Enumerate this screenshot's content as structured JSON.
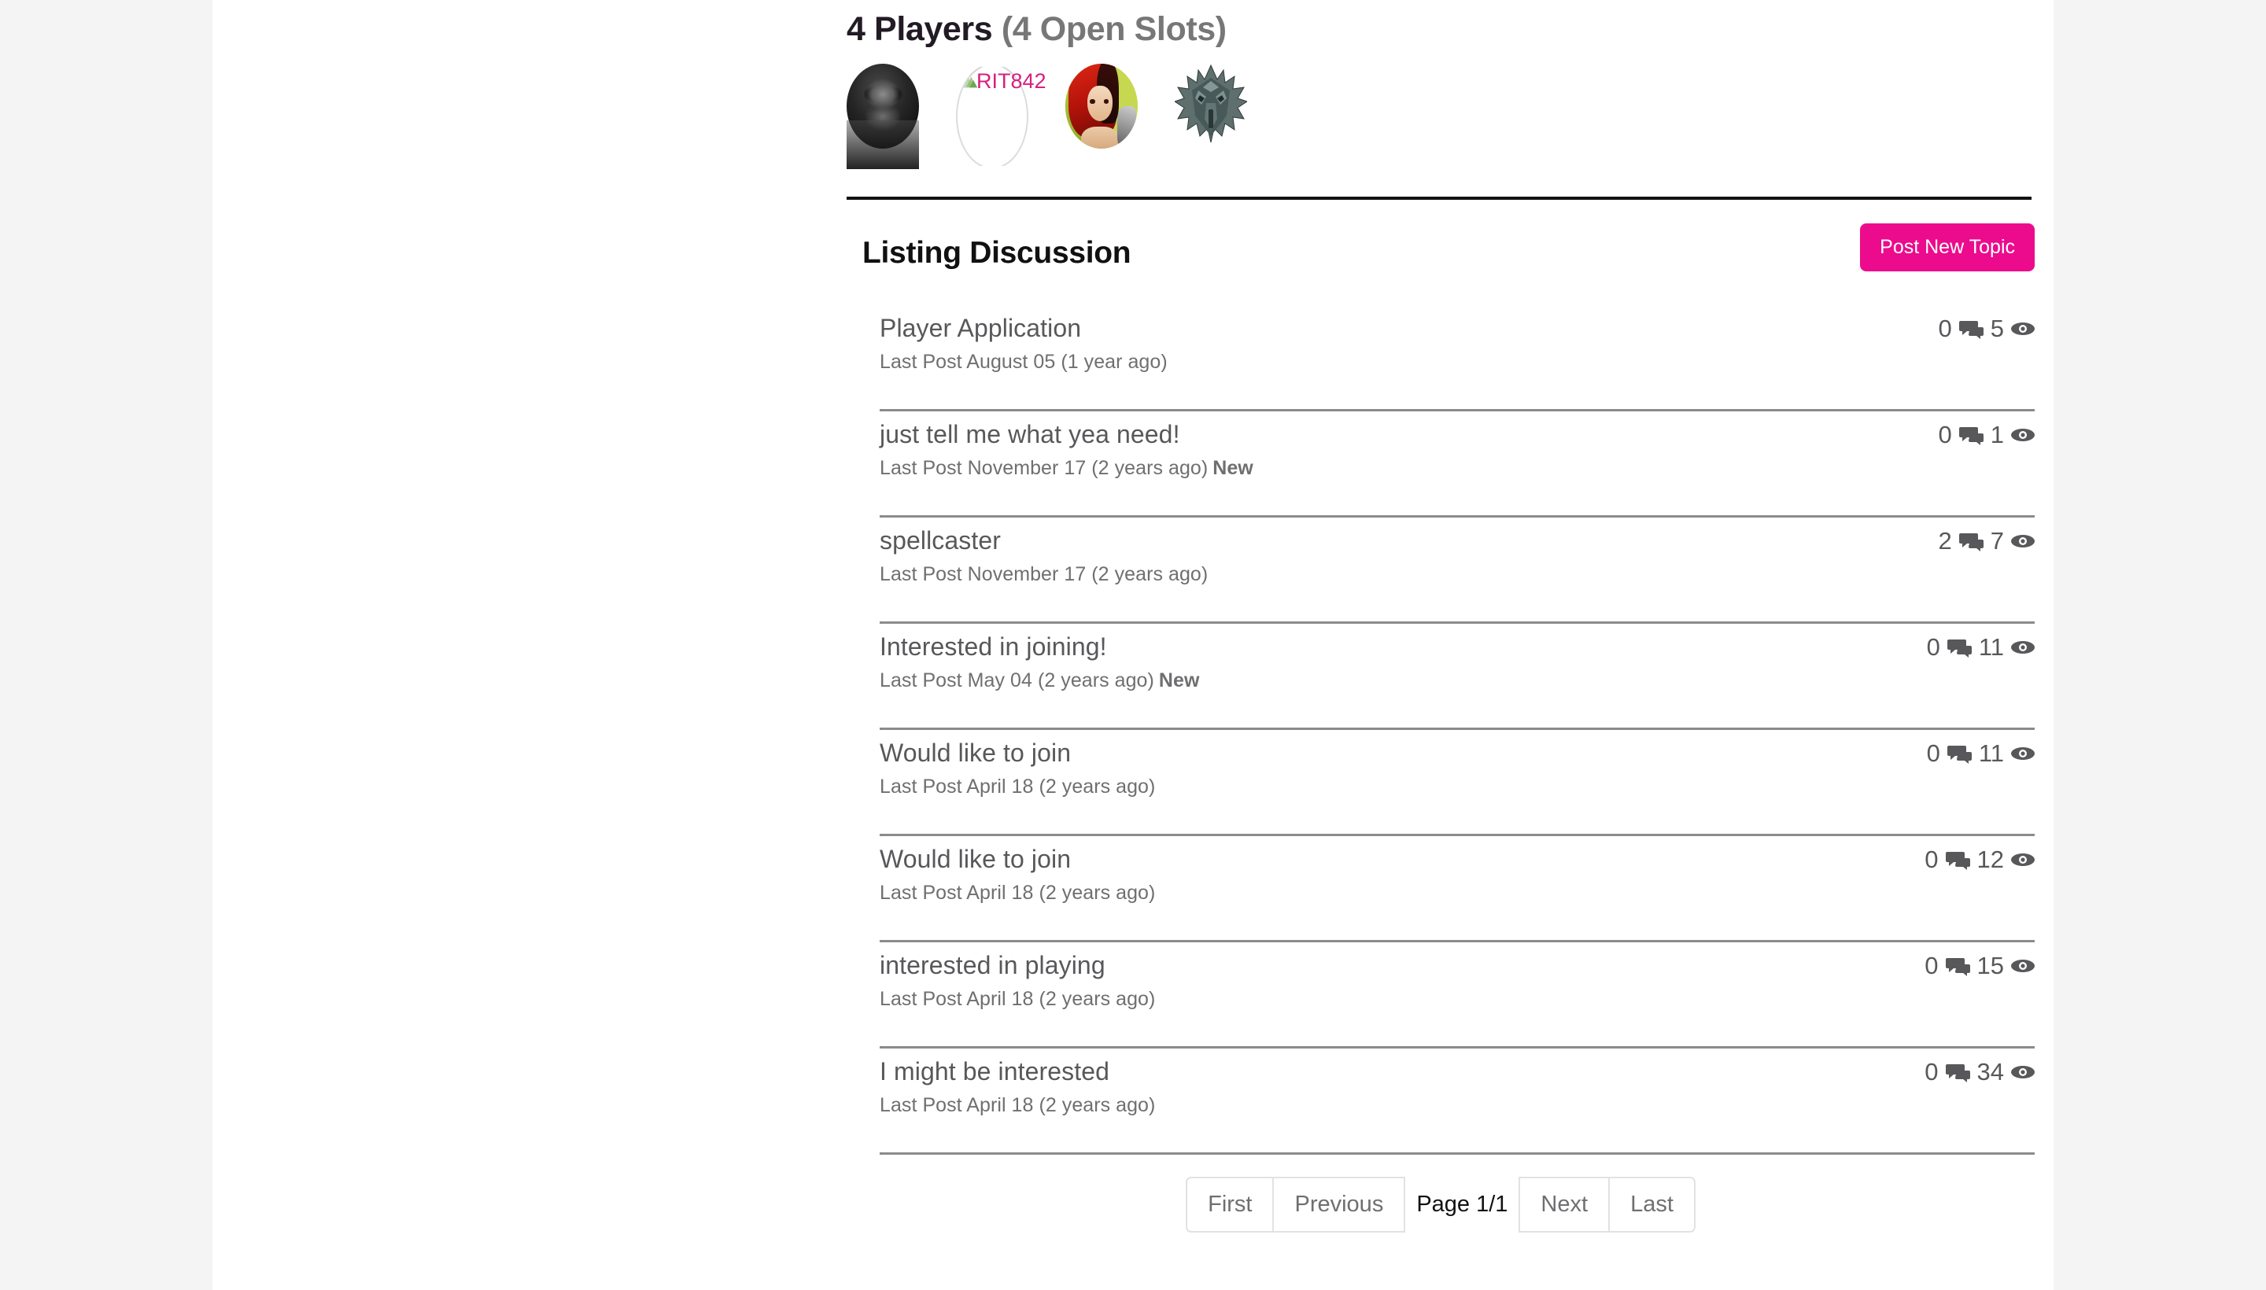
{
  "players": {
    "count_label": "4 Players",
    "slots_label": "(4 Open Slots)",
    "avatars": [
      {
        "name": "skull-avatar",
        "alt": ""
      },
      {
        "name": "broken-avatar",
        "alt": "RIT842"
      },
      {
        "name": "anime-avatar",
        "alt": ""
      },
      {
        "name": "wolf-medallion-avatar",
        "alt": ""
      }
    ]
  },
  "discussion": {
    "title": "Listing Discussion",
    "post_button": "Post New Topic",
    "accent_color": "#ec0b8c",
    "icons": {
      "comments": "comments-icon",
      "views": "eye-icon"
    },
    "topics": [
      {
        "title": "Player Application",
        "last_post": "Last Post August 05 (1 year ago)",
        "new_badge": "",
        "comments": "0",
        "views": "5"
      },
      {
        "title": "just tell me what yea need!",
        "last_post": "Last Post November 17 (2 years ago)",
        "new_badge": "New",
        "comments": "0",
        "views": "1"
      },
      {
        "title": "spellcaster",
        "last_post": "Last Post November 17 (2 years ago)",
        "new_badge": "",
        "comments": "2",
        "views": "7"
      },
      {
        "title": "Interested in joining!",
        "last_post": "Last Post May 04 (2 years ago)",
        "new_badge": "New",
        "comments": "0",
        "views": "11"
      },
      {
        "title": "Would like to join",
        "last_post": "Last Post April 18 (2 years ago)",
        "new_badge": "",
        "comments": "0",
        "views": "11"
      },
      {
        "title": "Would like to join",
        "last_post": "Last Post April 18 (2 years ago)",
        "new_badge": "",
        "comments": "0",
        "views": "12"
      },
      {
        "title": "interested in playing",
        "last_post": "Last Post April 18 (2 years ago)",
        "new_badge": "",
        "comments": "0",
        "views": "15"
      },
      {
        "title": "I might be interested",
        "last_post": "Last Post April 18 (2 years ago)",
        "new_badge": "",
        "comments": "0",
        "views": "34"
      }
    ]
  },
  "pagination": {
    "first": "First",
    "previous": "Previous",
    "current": "Page 1/1",
    "next": "Next",
    "last": "Last"
  }
}
